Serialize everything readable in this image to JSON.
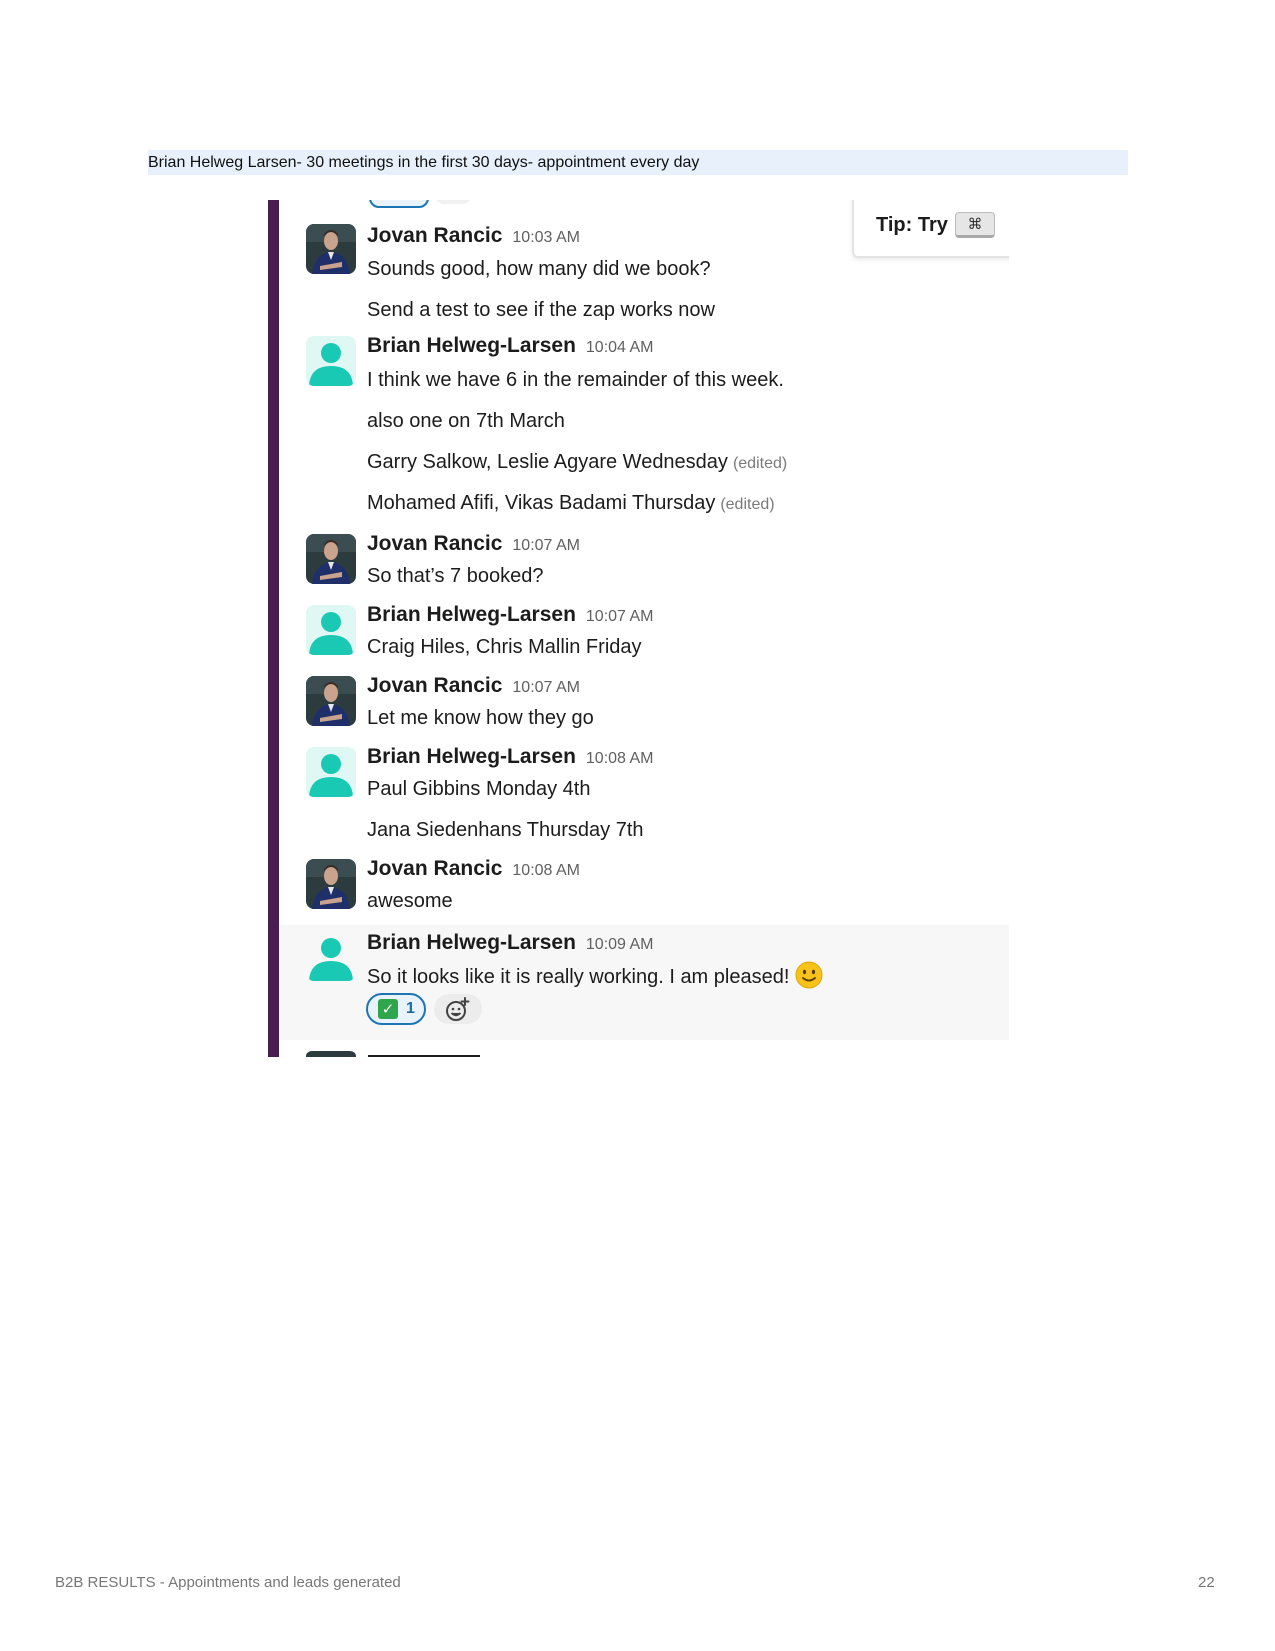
{
  "document": {
    "heading": "Brian Helweg Larsen- 30 meetings in the first 30 days- appointment every day",
    "footer_left": "B2B RESULTS - Appointments and leads generated",
    "page_number": "22"
  },
  "tip": {
    "label": "Tip: Try",
    "key_icon": "command-key-icon",
    "key_glyph": "⌘"
  },
  "colors": {
    "accent_bar": "#4a1d4f",
    "highlight_row": "#f7f7f7",
    "avatar_teal": "#19c9b4",
    "reaction_border": "#1d75b3"
  },
  "messages": [
    {
      "sender": "Jovan Rancic",
      "time": "10:03 AM",
      "avatar": "photo-avatar",
      "lines": [
        "Sounds good, how many did we book?",
        "Send a test to see if the zap works now"
      ]
    },
    {
      "sender": "Brian Helweg-Larsen",
      "time": "10:04 AM",
      "avatar": "default-person-avatar",
      "lines": [
        {
          "text": "I think we have 6 in the remainder of this week."
        },
        {
          "text": "also one on 7th March"
        },
        {
          "text": "Garry Salkow, Leslie Agyare Wednesday",
          "edited": "(edited)"
        },
        {
          "text": "Mohamed Afifi, Vikas Badami Thursday",
          "edited": "(edited)"
        }
      ]
    },
    {
      "sender": "Jovan Rancic",
      "time": "10:07 AM",
      "avatar": "photo-avatar",
      "lines": [
        "So that’s 7 booked?"
      ]
    },
    {
      "sender": "Brian Helweg-Larsen",
      "time": "10:07 AM",
      "avatar": "default-person-avatar",
      "lines": [
        "Craig Hiles, Chris Mallin Friday"
      ]
    },
    {
      "sender": "Jovan Rancic",
      "time": "10:07 AM",
      "avatar": "photo-avatar",
      "lines": [
        "Let me know how they go"
      ]
    },
    {
      "sender": "Brian Helweg-Larsen",
      "time": "10:08 AM",
      "avatar": "default-person-avatar",
      "lines": [
        "Paul Gibbins Monday 4th",
        "Jana Siedenhans Thursday 7th"
      ]
    },
    {
      "sender": "Jovan Rancic",
      "time": "10:08 AM",
      "avatar": "photo-avatar",
      "lines": [
        "awesome"
      ]
    },
    {
      "sender": "Brian Helweg-Larsen",
      "time": "10:09 AM",
      "avatar": "default-person-avatar",
      "lines": [
        "So it looks like it is really working. I am pleased!"
      ],
      "emoji": "slightly-smiling-face-icon",
      "reaction": {
        "emoji": "white-check-mark-icon",
        "count": "1"
      },
      "add_reaction_icon": "add-reaction-icon"
    }
  ]
}
